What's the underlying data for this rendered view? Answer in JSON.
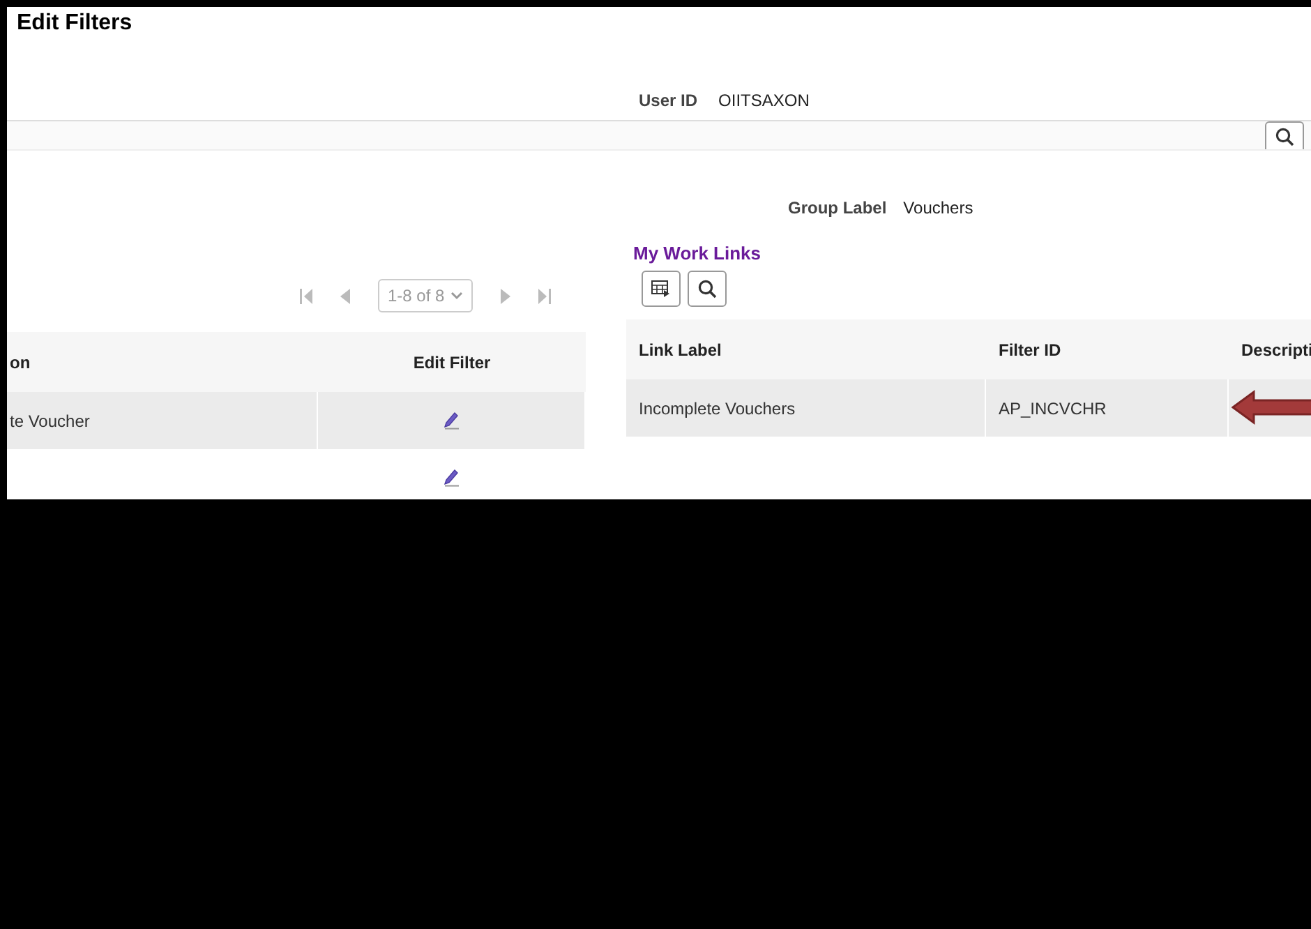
{
  "title": "Edit Filters",
  "user_id": {
    "label": "User ID",
    "value": "OIITSAXON"
  },
  "group_label": {
    "label": "Group Label",
    "value": "Vouchers"
  },
  "left_grid": {
    "pager": "1-8 of 8",
    "columns": [
      "on",
      "Edit Filter"
    ],
    "rows": [
      {
        "description": "te Voucher",
        "highlighted": true
      },
      {
        "highlighted": false
      }
    ]
  },
  "links": {
    "title": "My Work Links",
    "columns": [
      "Link Label",
      "Filter ID",
      "Descripti"
    ],
    "rows": [
      {
        "link_label": "Incomplete Vouchers",
        "filter_id": "AP_INCVCHR",
        "highlighted": true,
        "arrow": true
      }
    ]
  }
}
